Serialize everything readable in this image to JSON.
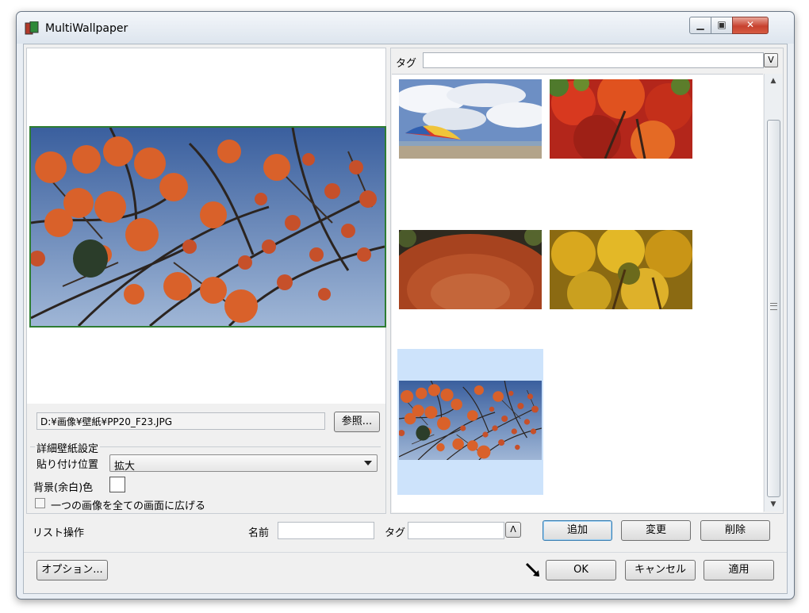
{
  "window": {
    "title": "MultiWallpaper",
    "icon": "app-icon",
    "controls": [
      "minimize",
      "maximize",
      "close"
    ]
  },
  "preview": {
    "file_path": "D:¥画像¥壁紙¥PP20_F23.JPG",
    "browse_label": "参照..."
  },
  "detail_settings": {
    "group_title": "詳細壁紙設定",
    "position_label": "貼り付け位置",
    "position_value": "拡大",
    "background_label": "背景(余白)色",
    "background_color": "#ffffff",
    "span_all_label": "一つの画像を全ての画面に広げる",
    "span_all_checked": false
  },
  "tag_filter": {
    "label": "タグ",
    "value": "",
    "dropdown_glyph": "V"
  },
  "thumbnails": [
    {
      "name": "beach-umbrella",
      "selected": false
    },
    {
      "name": "red-autumn-maple",
      "selected": false
    },
    {
      "name": "fisheye-autumn-leaves",
      "selected": false
    },
    {
      "name": "yellow-autumn-tree",
      "selected": false
    },
    {
      "name": "persimmon-tree",
      "selected": true
    }
  ],
  "list_ops": {
    "label": "リスト操作",
    "name_label": "名前",
    "name_value": "",
    "tag_label": "タグ",
    "tag_value": "",
    "tag_toggle_glyph": "Λ",
    "add_label": "追加",
    "change_label": "変更",
    "delete_label": "削除"
  },
  "footer": {
    "options_label": "オプション...",
    "ok_label": "OK",
    "cancel_label": "キャンセル",
    "apply_label": "適用"
  },
  "colors": {
    "selection": "#cde3fb",
    "preview_border": "#2e7d32",
    "close_button": "#c7422f"
  }
}
